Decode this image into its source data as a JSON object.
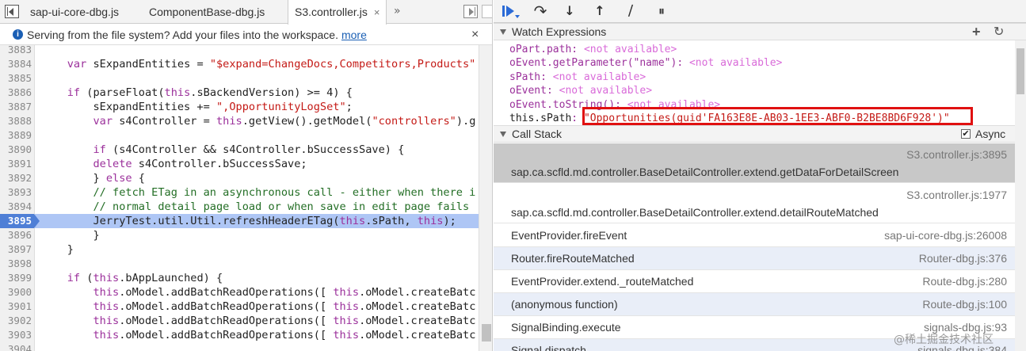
{
  "editor": {
    "tabs": [
      {
        "label": "sap-ui-core-dbg.js"
      },
      {
        "label": "ComponentBase-dbg.js"
      },
      {
        "label": "S3.controller.js",
        "close": "×"
      }
    ],
    "more_tabs": "»",
    "infobar": {
      "message": "Serving from the file system? Add your files into the workspace.",
      "link": "more",
      "close": "×"
    },
    "lines": [
      {
        "n": "3883",
        "html": ""
      },
      {
        "n": "3884",
        "html": "    <span class='kw'>var</span> sExpandEntities = <span class='str'>\"$expand=ChangeDocs,Competitors,Products\"</span>"
      },
      {
        "n": "3885",
        "html": ""
      },
      {
        "n": "3886",
        "html": "    <span class='kw'>if</span> (parseFloat(<span class='this'>this</span>.sBackendVersion) >= 4) {"
      },
      {
        "n": "3887",
        "html": "        sExpandEntities += <span class='str'>\",OpportunityLogSet\"</span>;"
      },
      {
        "n": "3888",
        "html": "        <span class='kw'>var</span> s4Controller = <span class='this'>this</span>.getView().getModel(<span class='str'>\"controllers\"</span>).g"
      },
      {
        "n": "3889",
        "html": ""
      },
      {
        "n": "3890",
        "html": "        <span class='kw'>if</span> (s4Controller && s4Controller.bSuccessSave) {"
      },
      {
        "n": "3891",
        "html": "        <span class='kw'>delete</span> s4Controller.bSuccessSave;"
      },
      {
        "n": "3892",
        "html": "        } <span class='kw'>else</span> {"
      },
      {
        "n": "3893",
        "html": "        <span class='cm'>// fetch ETag in an asynchronous call - either when there i</span>"
      },
      {
        "n": "3894",
        "html": "        <span class='cm'>// normal detail page load or when save in edit page fails</span>"
      },
      {
        "n": "3895",
        "html": "        JerryTest.util.Util.refreshHeaderETag(<span class='this'>this</span>.sPath, <span class='this'>this</span>);",
        "exec": true
      },
      {
        "n": "3896",
        "html": "        }"
      },
      {
        "n": "3897",
        "html": "    }"
      },
      {
        "n": "3898",
        "html": ""
      },
      {
        "n": "3899",
        "html": "    <span class='kw'>if</span> (<span class='this'>this</span>.bAppLaunched) {"
      },
      {
        "n": "3900",
        "html": "        <span class='this'>this</span>.oModel.addBatchReadOperations([ <span class='this'>this</span>.oModel.createBatc"
      },
      {
        "n": "3901",
        "html": "        <span class='this'>this</span>.oModel.addBatchReadOperations([ <span class='this'>this</span>.oModel.createBatc"
      },
      {
        "n": "3902",
        "html": "        <span class='this'>this</span>.oModel.addBatchReadOperations([ <span class='this'>this</span>.oModel.createBatc"
      },
      {
        "n": "3903",
        "html": "        <span class='this'>this</span>.oModel.addBatchReadOperations([ <span class='this'>this</span>.oModel.createBatc"
      },
      {
        "n": "3904",
        "html": ""
      }
    ]
  },
  "debugger": {
    "toolbar": {
      "step_over": "↷",
      "step_into": "↓",
      "step_out": "↑",
      "deactivate": "⧸",
      "pause_exceptions": "⏸"
    },
    "watch": {
      "title": "Watch Expressions",
      "add": "+",
      "refresh": "↻",
      "rows": [
        {
          "expr": "oPart.path",
          "value": "<not available>"
        },
        {
          "expr": "oEvent.getParameter(\"name\")",
          "value": "<not available>"
        },
        {
          "expr": "sPath",
          "value": "<not available>"
        },
        {
          "expr": "oEvent",
          "value": "<not available>"
        },
        {
          "expr": "oEvent.toString()",
          "value": "<not available>"
        },
        {
          "expr": "this.sPath",
          "value": "\"Opportunities(guid'FA163E8E-AB03-1EE3-ABF0-B2BE8BD6F928')\"",
          "current": true
        }
      ]
    },
    "callstack": {
      "title": "Call Stack",
      "async_label": "Async",
      "async_checked": "✔",
      "frames": [
        {
          "fn": "sap.ca.scfld.md.controller.BaseDetailController.extend.getDataForDetailScreen",
          "loc": "S3.controller.js:3895",
          "kind": "tall selected"
        },
        {
          "fn": "sap.ca.scfld.md.controller.BaseDetailController.extend.detailRouteMatched",
          "loc": "S3.controller.js:1977",
          "kind": "tall"
        },
        {
          "fn": "EventProvider.fireEvent",
          "loc": "sap-ui-core-dbg.js:26008",
          "kind": "short"
        },
        {
          "fn": "Router.fireRouteMatched",
          "loc": "Router-dbg.js:376",
          "kind": "short async"
        },
        {
          "fn": "EventProvider.extend._routeMatched",
          "loc": "Route-dbg.js:280",
          "kind": "short"
        },
        {
          "fn": "(anonymous function)",
          "loc": "Route-dbg.js:100",
          "kind": "short async"
        },
        {
          "fn": "SignalBinding.execute",
          "loc": "signals-dbg.js:93",
          "kind": "short"
        },
        {
          "fn": "Signal.dispatch",
          "loc": "signals-dbg.js:384",
          "kind": "short async"
        }
      ]
    }
  },
  "watermark": "@稀土掘金技术社区"
}
